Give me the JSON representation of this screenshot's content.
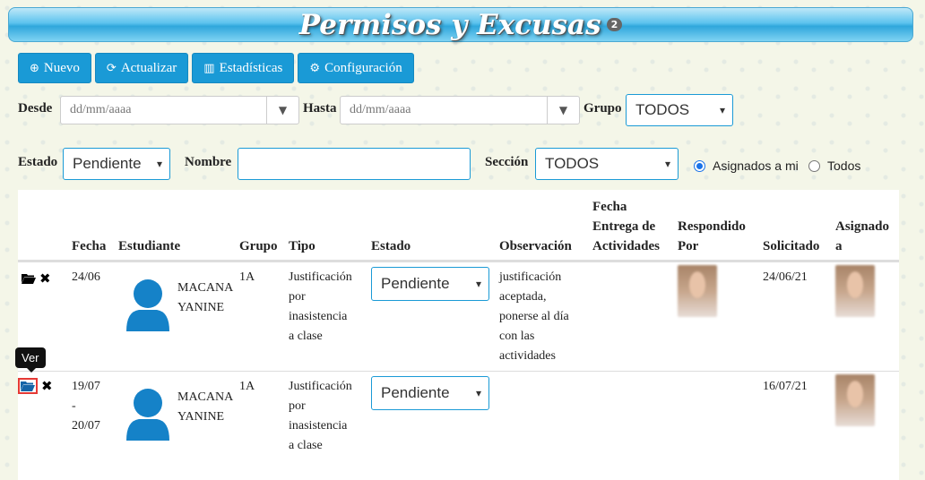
{
  "header": {
    "title": "Permisos y Excusas",
    "badge": "2"
  },
  "toolbar": {
    "new_label": "Nuevo",
    "refresh_label": "Actualizar",
    "stats_label": "Estadísticas",
    "config_label": "Configuración"
  },
  "filters": {
    "desde_label": "Desde",
    "desde_placeholder": "dd/mm/aaaa",
    "hasta_label": "Hasta",
    "hasta_placeholder": "dd/mm/aaaa",
    "grupo_label": "Grupo",
    "grupo_value": "TODOS",
    "estado_label": "Estado",
    "estado_value": "Pendiente",
    "nombre_label": "Nombre",
    "nombre_value": "",
    "seccion_label": "Sección",
    "seccion_value": "TODOS",
    "radio_assigned_label": "Asignados a mi",
    "radio_all_label": "Todos"
  },
  "table": {
    "headers": {
      "fecha": "Fecha",
      "estudiante": "Estudiante",
      "grupo": "Grupo",
      "tipo": "Tipo",
      "estado": "Estado",
      "observacion": "Observación",
      "entrega_1": "Fecha",
      "entrega_2": "Entrega de",
      "entrega_3": "Actividades",
      "respondido_1": "Respondido",
      "respondido_2": "Por",
      "solicitado": "Solicitado",
      "asignado_1": "Asignado",
      "asignado_2": "a"
    },
    "rows": [
      {
        "fecha": "24/06",
        "fecha_2": "",
        "fecha_3": "",
        "estudiante_1": "MACANA",
        "estudiante_2": "YANINE",
        "grupo": "1A",
        "tipo_1": "Justificación",
        "tipo_2": "por",
        "tipo_3": "inasistencia",
        "tipo_4": "a clase",
        "estado": "Pendiente",
        "obs_1": "justificación",
        "obs_2": "aceptada,",
        "obs_3": "ponerse al día",
        "obs_4": "con las",
        "obs_5": "actividades",
        "solicitado": "24/06/21"
      },
      {
        "fecha": "19/07",
        "fecha_2": "-",
        "fecha_3": "20/07",
        "estudiante_1": "MACANA",
        "estudiante_2": "YANINE",
        "grupo": "1A",
        "tipo_1": "Justificación",
        "tipo_2": "por",
        "tipo_3": "inasistencia",
        "tipo_4": "a clase",
        "estado": "Pendiente",
        "solicitado": "16/07/21"
      }
    ]
  },
  "tooltip": {
    "text": "Ver"
  },
  "colors": {
    "accent": "#1a9ad6",
    "highlight": "#e53935"
  },
  "icons": {
    "new": "plus-circle-icon",
    "refresh": "refresh-icon",
    "stats": "bar-chart-icon",
    "config": "gear-icon",
    "open": "folder-open-icon",
    "delete": "close-icon"
  }
}
